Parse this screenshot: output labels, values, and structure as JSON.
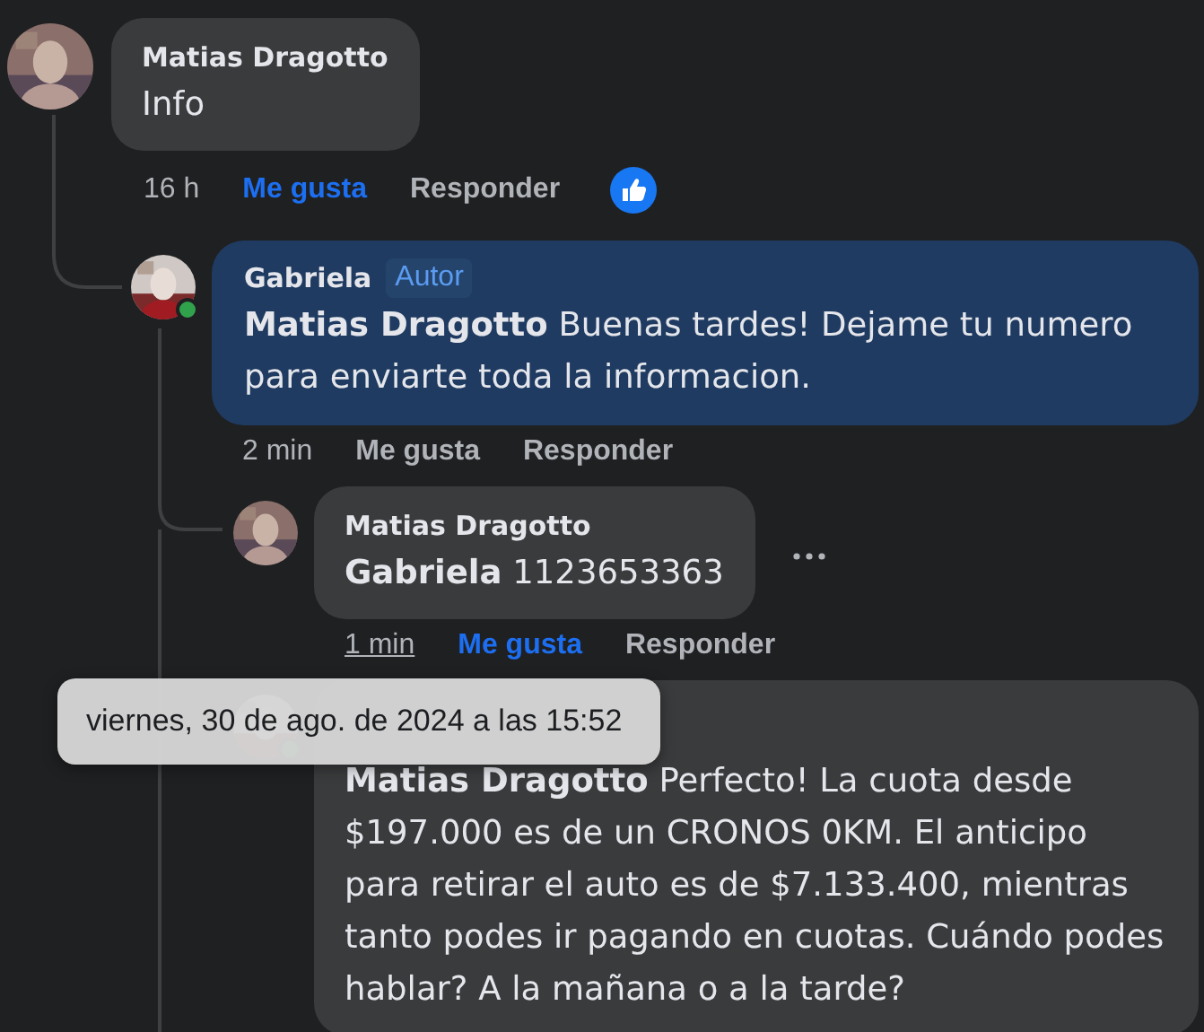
{
  "comments": [
    {
      "name": "Matias Dragotto",
      "text": "Info",
      "time": "16 h",
      "like_label": "Me gusta",
      "reply_label": "Responder",
      "liked": true,
      "reaction": true,
      "time_hovered": false,
      "children": [
        {
          "name": "Gabriela",
          "badge": "Autor",
          "author": true,
          "text": "**Matias Dragotto** Buenas tardes! Dejame tu numero para enviarte toda la informacion.",
          "time": "2 min",
          "like_label": "Me gusta",
          "reply_label": "Responder",
          "liked": false,
          "online": true,
          "time_hovered": false,
          "children": [
            {
              "name": "Matias Dragotto",
              "text": "**Gabriela** 1123653363",
              "time": "1 min",
              "like_label": "Me gusta",
              "reply_label": "Responder",
              "liked": true,
              "time_hovered": true,
              "menu_shown": true
            },
            {
              "text": "**Matias Dragotto** Perfecto! La cuota desde $197.000 es de un CRONOS 0KM. El anticipo para retirar el auto es de $7.133.400, mientras tanto podes ir pagando en cuotas. Cuándo podes hablar? A la mañana o a la tarde?",
              "online": true
            }
          ]
        }
      ]
    }
  ],
  "tooltip": {
    "text": "viernes, 30 de ago. de 2024 a las 15:52"
  }
}
